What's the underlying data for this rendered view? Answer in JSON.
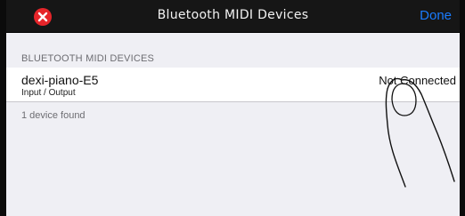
{
  "navbar": {
    "title": "Bluetooth MIDI Devices",
    "done_label": "Done",
    "close_icon": "close-icon",
    "colors": {
      "close": "#e6252a",
      "done": "#1a7cff",
      "bar": "#161616"
    }
  },
  "section": {
    "header": "BLUETOOTH MIDI DEVICES"
  },
  "devices": [
    {
      "name": "dexi-piano-E5",
      "type": "Input / Output",
      "status": "Not Connected"
    }
  ],
  "footer": "1 device found",
  "overlay": {
    "icon": "pointing-finger-icon"
  }
}
